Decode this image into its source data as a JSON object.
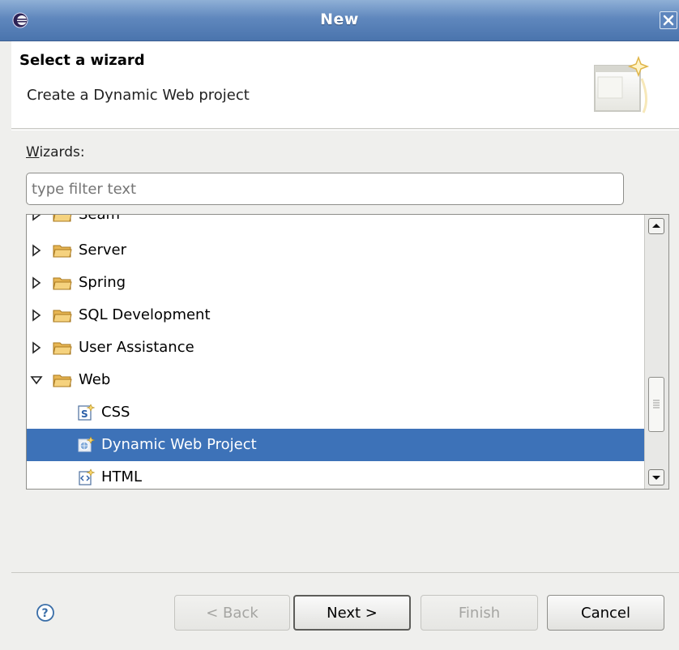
{
  "window": {
    "title": "New"
  },
  "header": {
    "title": "Select a wizard",
    "description": "Create a Dynamic Web project"
  },
  "wizards_label": "Wizards:",
  "filter": {
    "value": "",
    "placeholder": "type filter text"
  },
  "tree": {
    "items": [
      {
        "label": "Seam",
        "type": "folder",
        "expanded": false
      },
      {
        "label": "Server",
        "type": "folder",
        "expanded": false
      },
      {
        "label": "Spring",
        "type": "folder",
        "expanded": false
      },
      {
        "label": "SQL Development",
        "type": "folder",
        "expanded": false
      },
      {
        "label": "User Assistance",
        "type": "folder",
        "expanded": false
      },
      {
        "label": "Web",
        "type": "folder",
        "expanded": true
      },
      {
        "label": "CSS",
        "type": "leaf",
        "icon": "css-file-icon"
      },
      {
        "label": "Dynamic Web Project",
        "type": "leaf",
        "icon": "dynamic-web-project-icon",
        "selected": true
      },
      {
        "label": "HTML",
        "type": "leaf",
        "icon": "html-file-icon"
      }
    ]
  },
  "buttons": {
    "back": "< Back",
    "next": "Next >",
    "finish": "Finish",
    "cancel": "Cancel"
  },
  "colors": {
    "selection": "#3d72b8",
    "titlebar": "#5f87bd"
  }
}
